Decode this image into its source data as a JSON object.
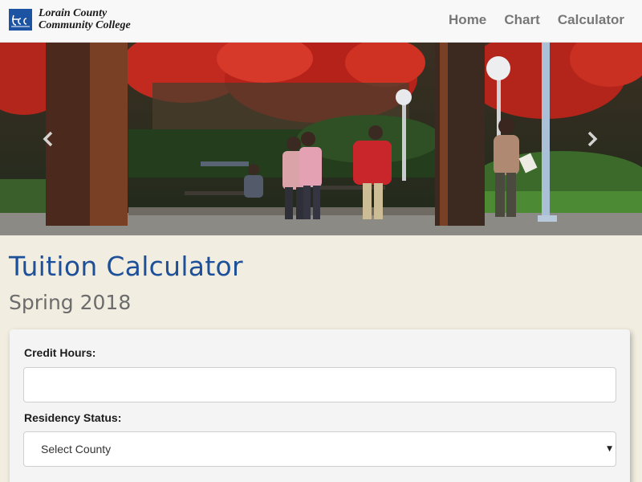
{
  "brand": {
    "name_line1": "Lorain County",
    "name_line2": "Community College",
    "logo_icon": "lccc-logo-icon",
    "brand_color": "#1c53a3"
  },
  "nav": {
    "items": [
      {
        "label": "Home"
      },
      {
        "label": "Chart"
      },
      {
        "label": "Calculator"
      }
    ]
  },
  "carousel": {
    "prev_icon": "chevron-left-icon",
    "next_icon": "chevron-right-icon"
  },
  "page": {
    "title": "Tuition Calculator",
    "subtitle": "Spring 2018",
    "title_color": "#1d5099",
    "background_color": "#f1ede0"
  },
  "form": {
    "credit_hours": {
      "label": "Credit Hours:",
      "value": "",
      "placeholder": ""
    },
    "residency": {
      "label": "Residency Status:",
      "selected": "Select County",
      "caret_icon": "caret-down-icon"
    }
  }
}
